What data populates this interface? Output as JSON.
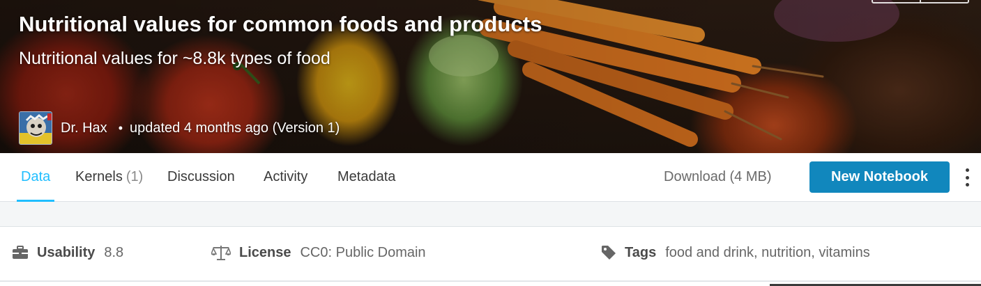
{
  "hero": {
    "title": "Nutritional values for common foods and products",
    "subtitle": "Nutritional values for ~8.8k types of food",
    "author": "Dr. Hax",
    "separator": "•",
    "updated": "updated 4 months ago (Version 1)"
  },
  "tabs": [
    {
      "label": "Data",
      "active": true
    },
    {
      "label": "Kernels",
      "count": "(1)"
    },
    {
      "label": "Discussion"
    },
    {
      "label": "Activity"
    },
    {
      "label": "Metadata"
    }
  ],
  "toolbar": {
    "download_label": "Download (4 MB)",
    "new_notebook_label": "New Notebook"
  },
  "info": {
    "usability": {
      "label": "Usability",
      "value": "8.8",
      "icon": "toolbox-icon"
    },
    "license": {
      "label": "License",
      "value": "CC0: Public Domain",
      "icon": "scale-icon"
    },
    "tags": {
      "label": "Tags",
      "value": "food and drink, nutrition, vitamins",
      "icon": "tag-icon"
    }
  },
  "colors": {
    "accent": "#20beff",
    "primary_button": "#1187bd",
    "muted_text": "#666666"
  }
}
